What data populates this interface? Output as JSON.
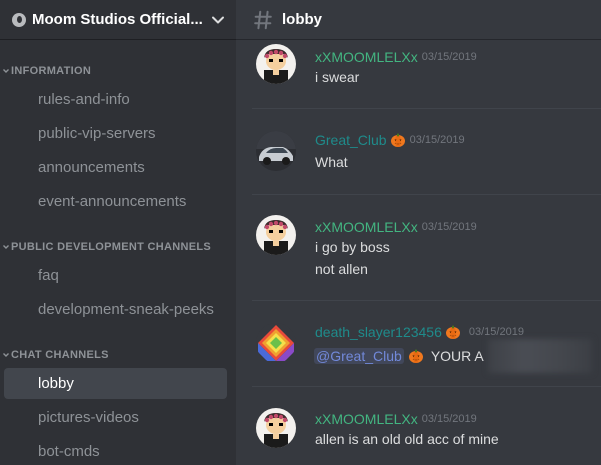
{
  "server": {
    "name": "Moom Studios Official..."
  },
  "categories": [
    {
      "label": "INFORMATION"
    },
    {
      "label": "PUBLIC DEVELOPMENT CHANNELS"
    },
    {
      "label": "CHAT CHANNELS"
    }
  ],
  "channels": [
    {
      "name": "rules-and-info"
    },
    {
      "name": "public-vip-servers"
    },
    {
      "name": "announcements"
    },
    {
      "name": "event-announcements"
    },
    {
      "name": "faq"
    },
    {
      "name": "development-sneak-peeks"
    },
    {
      "name": "lobby"
    },
    {
      "name": "pictures-videos"
    },
    {
      "name": "bot-cmds"
    }
  ],
  "chat": {
    "channel": "lobby"
  },
  "colors": {
    "green_user": "#43b581",
    "teal_user": "#1f8b8b",
    "mention": "#7289da"
  },
  "messages": [
    {
      "author": "xXMOOMLELXx",
      "timestamp": "03/15/2019",
      "lines": [
        "i swear"
      ]
    },
    {
      "author": "Great_Club",
      "badge": "pumpkin-icon",
      "timestamp": "03/15/2019",
      "lines": [
        "What"
      ]
    },
    {
      "author": "xXMOOMLELXx",
      "timestamp": "03/15/2019",
      "lines": [
        "i go by boss",
        "not allen"
      ]
    },
    {
      "author": "death_slayer123456",
      "badge": "pumpkin-icon",
      "timestamp": "03/15/2019",
      "mention": "@Great_Club",
      "text_after": "YOUR A"
    },
    {
      "author": "xXMOOMLELXx",
      "timestamp": "03/15/2019",
      "lines": [
        "allen is an old old acc of mine"
      ]
    }
  ]
}
